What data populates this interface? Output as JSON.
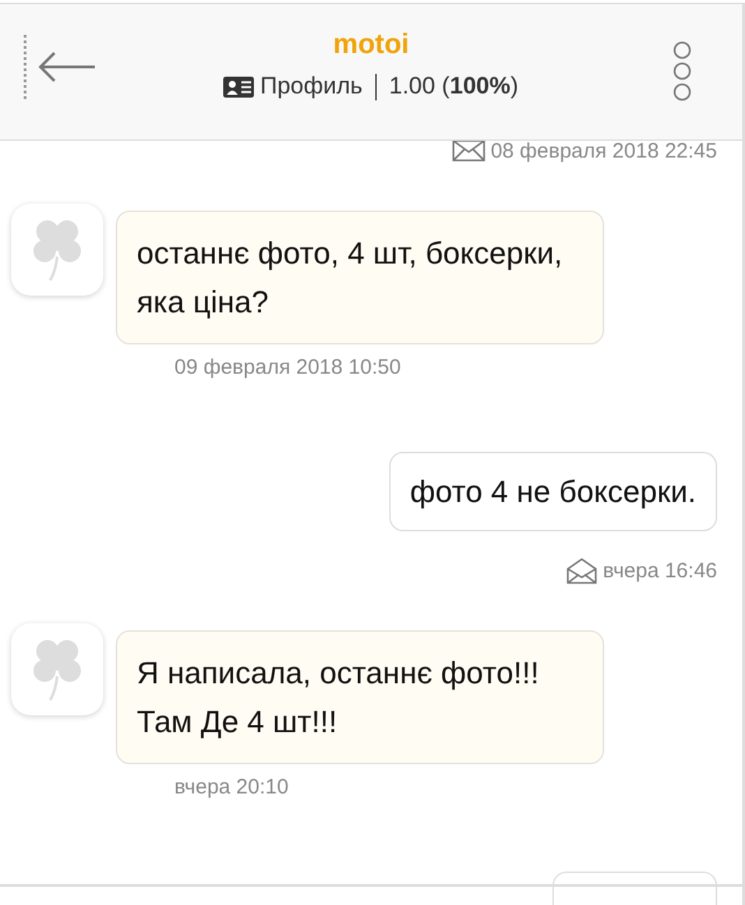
{
  "header": {
    "title": "motoi",
    "profile_label": "Профиль",
    "rating": "1.00 (**100%**)"
  },
  "messages": [
    {
      "kind": "stamp",
      "time": "08 февраля 2018 22:45",
      "read": false
    },
    {
      "kind": "incoming",
      "text": "останнє фото, 4 шт, боксерки, яка ціна?",
      "time": "09 февраля 2018 10:50"
    },
    {
      "kind": "outgoing",
      "text": "фото 4 не боксерки.",
      "time": "вчера 16:46",
      "read": true
    },
    {
      "kind": "incoming",
      "text": "Я написала, останнє фото!!! Там Де 4 шт!!!",
      "time": "вчера 20:10"
    },
    {
      "kind": "partial"
    }
  ]
}
